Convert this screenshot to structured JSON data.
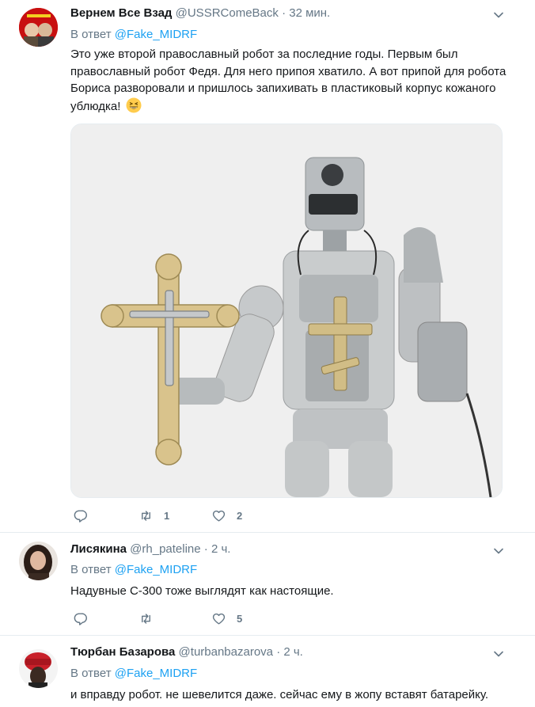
{
  "tweets": [
    {
      "name": "Вернем Все Взад",
      "handle": "@USSRComeBack",
      "time": "32 мин.",
      "reply_prefix": "В ответ",
      "reply_to": "@Fake_MIDRF",
      "text": "Это уже второй православный робот за последние годы. Первым был православный робот Федя. Для него припоя хватило. А вот припой для робота Бориса разворовали и пришлось запихивать в пластиковый корпус кожаного ублюдка!",
      "emoji": "grinning-squinting-face",
      "replies": "",
      "retweets": "1",
      "likes": "2"
    },
    {
      "name": "Лисякина",
      "handle": "@rh_pateline",
      "time": "2 ч.",
      "reply_prefix": "В ответ",
      "reply_to": "@Fake_MIDRF",
      "text": "Надувные С-300 тоже выглядят как настоящие.",
      "replies": "",
      "retweets": "",
      "likes": "5"
    },
    {
      "name": "Тюрбан Базарова",
      "handle": "@turbanbazarova",
      "time": "2 ч.",
      "reply_prefix": "В ответ",
      "reply_to": "@Fake_MIDRF",
      "text": "и вправду робот. не шевелится даже. сейчас ему в жопу вставят батарейку."
    }
  ],
  "colors": {
    "link": "#1da1f2",
    "secondary_text": "#657786",
    "divider": "#e6ecf0"
  }
}
